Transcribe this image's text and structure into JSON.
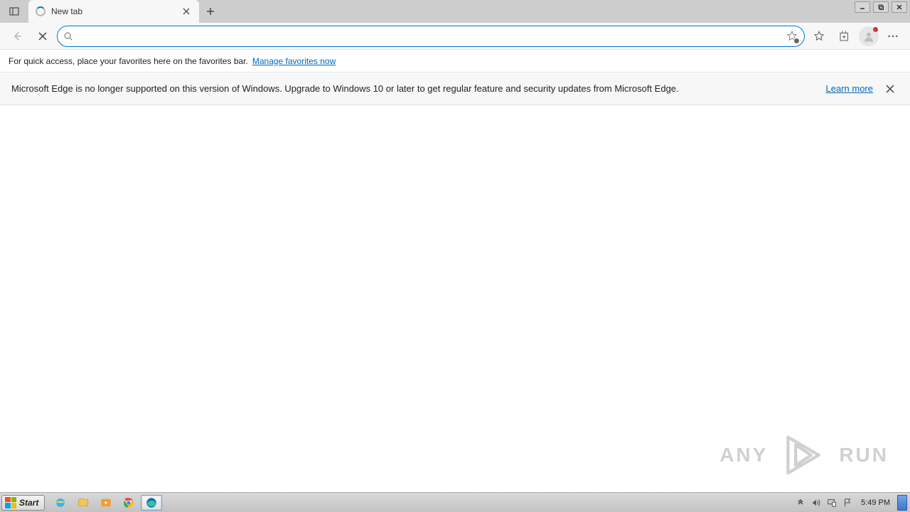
{
  "tab": {
    "title": "New tab"
  },
  "toolbar": {
    "address_value": "",
    "address_placeholder": ""
  },
  "favorites_hint": {
    "text": "For quick access, place your favorites here on the favorites bar.",
    "link": "Manage favorites now"
  },
  "notification": {
    "message": "Microsoft Edge is no longer supported on this version of Windows. Upgrade to Windows 10 or later to get regular feature and security updates from Microsoft Edge.",
    "link": "Learn more"
  },
  "watermark": {
    "text": "ANY",
    "text2": "RUN"
  },
  "taskbar": {
    "start_label": "Start",
    "clock": "5:49 PM"
  }
}
